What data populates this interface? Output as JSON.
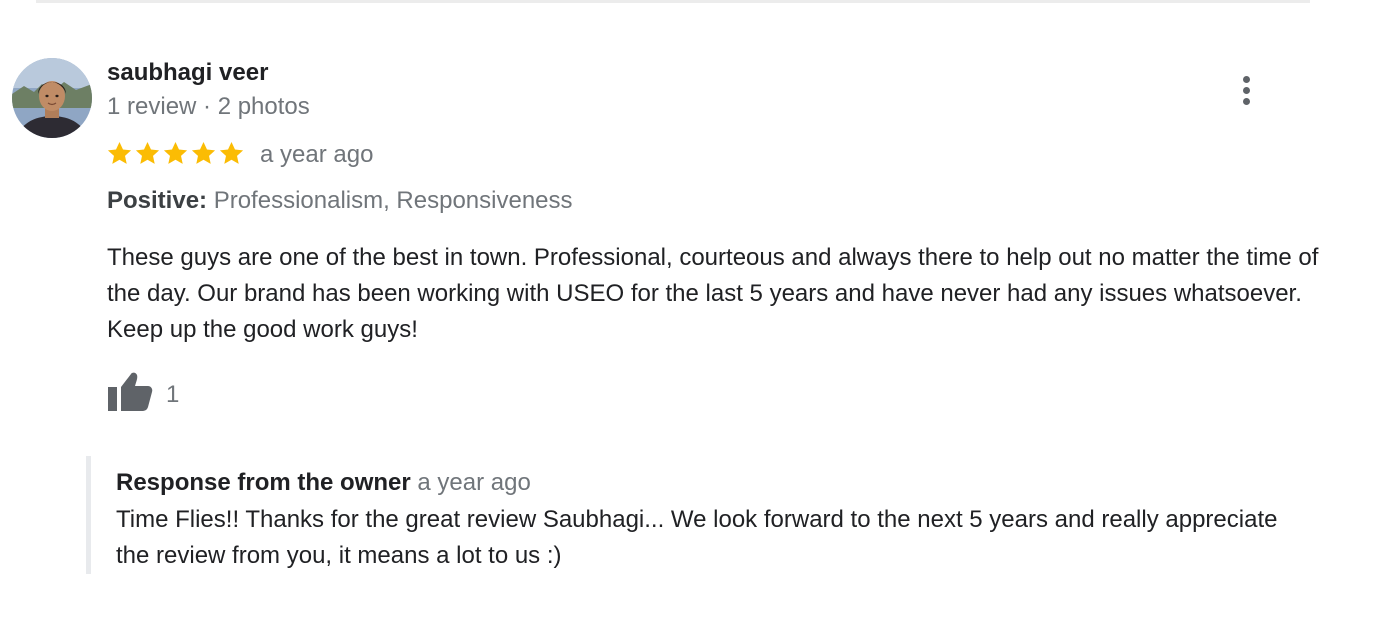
{
  "reviewer": {
    "name": "saubhagi veer",
    "meta": "1 review · 2 photos"
  },
  "rating": {
    "stars": 5,
    "max": 5,
    "color": "#fbbc04",
    "date": "a year ago"
  },
  "attributes": {
    "label": "Positive:",
    "values": "Professionalism, Responsiveness"
  },
  "review": {
    "text": "These guys are one of the best in town. Professional, courteous and always there to help out no matter the time of the day. Our brand has been working with USEO for the last 5 years and have never had any issues whatsoever. Keep up the good work guys!"
  },
  "likes": {
    "icon": "thumbs-up-icon",
    "count": "1"
  },
  "menu": {
    "icon": "more-vert-icon"
  },
  "owner_response": {
    "title": "Response from the owner",
    "date": "a year ago",
    "text": "Time Flies!! Thanks for the great review Saubhagi... We look forward to the next 5 years and really appreciate the review from you, it means a lot to us :)"
  }
}
